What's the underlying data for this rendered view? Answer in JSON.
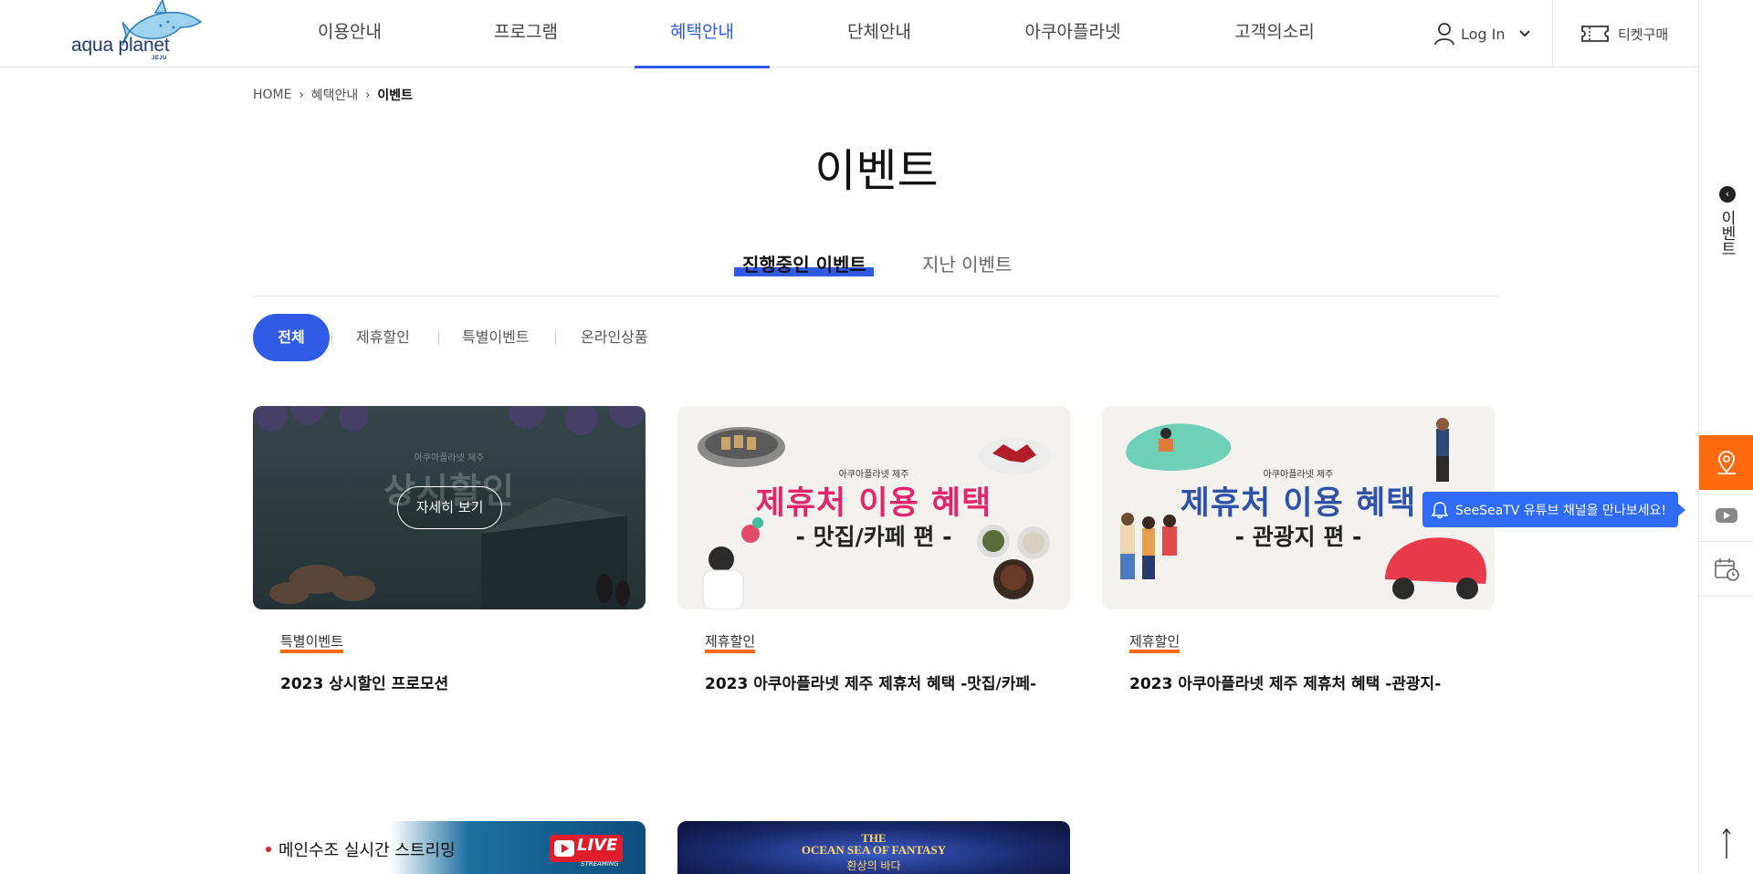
{
  "brand": {
    "logo_text": "aqua planet",
    "logo_sub": "JEJU"
  },
  "nav": {
    "items": [
      "이용안내",
      "프로그램",
      "혜택안내",
      "단체안내",
      "아쿠아플라넷",
      "고객의소리"
    ],
    "active_index": 2,
    "login_label": "Log In",
    "ticket_label": "티켓구매"
  },
  "breadcrumb": {
    "home": "HOME",
    "parent": "혜택안내",
    "current": "이벤트"
  },
  "page_title": "이벤트",
  "tabs": {
    "ongoing": "진행중인 이벤트",
    "past": "지난 이벤트"
  },
  "filters": {
    "all": "전체",
    "partner": "제휴할인",
    "special": "특별이벤트",
    "online": "온라인상품"
  },
  "cards": [
    {
      "tag": "특별이벤트",
      "title": "2023 상시할인 프로모션",
      "overlay_button": "자세히 보기",
      "thumb_sub": "아쿠아플라넷 제주",
      "thumb_main": "상시할인"
    },
    {
      "tag": "제휴할인",
      "title": "2023 아쿠아플라넷 제주 제휴처 혜택 -맛집/카페-",
      "thumb_sub": "아쿠아플라넷 제주",
      "thumb_main": "제휴처 이용 혜택",
      "thumb_tail": "- 맛집/카페 편 -"
    },
    {
      "tag": "제휴할인",
      "title": "2023 아쿠아플라넷 제주 제휴처 혜택 -관광지-",
      "thumb_sub": "아쿠아플라넷 제주",
      "thumb_main": "제휴처 이용 혜택",
      "thumb_tail": "- 관광지 편 -"
    }
  ],
  "cards_row2": [
    {
      "thumb_text": "메인수조 실시간 스트리밍",
      "badge": "LIVE",
      "badge_sub": "STREAMING"
    },
    {
      "thumb_title_1": "THE",
      "thumb_title_2": "OCEAN SEA OF FANTASY",
      "thumb_title_3": "환상의 바다"
    }
  ],
  "rail": {
    "event_label": "이벤트"
  },
  "tooltip": {
    "text": "SeeSeaTV 유튜브 채널을 만나보세요!"
  },
  "colors": {
    "accent": "#2f5be7",
    "orange": "#ff6a0f",
    "tooltip": "#2f6bf5"
  }
}
